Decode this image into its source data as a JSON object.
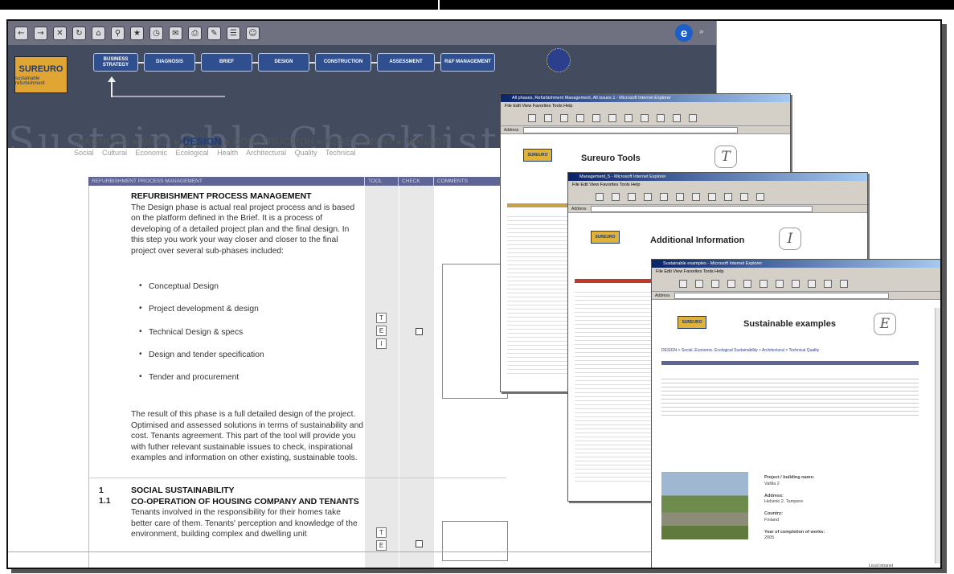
{
  "banner": {
    "logo": "SUREURO",
    "logo_sub": "sustainable refurbishment",
    "phases": [
      "BUSINESS STRATEGY",
      "DIAGNOSIS",
      "BRIEF",
      "DESIGN",
      "CONSTRUCTION",
      "ASSESSMENT",
      "R&F MANAGEMENT"
    ],
    "big_title": "Sustainable Checklist"
  },
  "breadcrumb": {
    "diagnosis": "DIAGNOSIS",
    "brief": "BRIEF",
    "design": "DESIGN",
    "construction": "CONSTRUCTION",
    "assessment": "ASSESSMENT",
    "manage": "MANAGE",
    "sep": "▸"
  },
  "aspects": "Social Cultural Economic Ecological Health Architectural Quality Technical",
  "table": {
    "headers": [
      "REFURBISHMENT PROCESS MANAGEMENT",
      "TOOL",
      "CHECK",
      "COMMENTS"
    ],
    "section1": {
      "title": "REFURBISHMENT PROCESS MANAGEMENT",
      "intro": "The Design phase is actual real project process and is based on the platform defined in the Brief. It is a process of developing of a detailed project plan and the final design. In this step you work your way closer and closer to the final project over several sub-phases included:",
      "bullets": [
        "Conceptual Design",
        "Project development & design",
        "Technical Design & specs",
        "Design and tender specification",
        "Tender and procurement"
      ],
      "outro": "The result of this phase is a full detailed design of the project. Optimised and assessed solutions in terms of sustainability and cost. Tenants agreement. This part of the tool will provide you with futher relevant sustainable issues to check, inspirational examples and information on other existing, sustainable tools.",
      "tools": [
        "T",
        "E",
        "I"
      ]
    },
    "section2": {
      "num1": "1",
      "num2": "1.1",
      "title1": "SOCIAL SUSTAINABILITY",
      "title2": "CO-OPERATION OF HOUSING COMPANY AND TENANTS",
      "text": "Tenants involved in the responsibility for their homes take better care of them. Tenants' perception and knowledge of the environment, building complex and dwelling unit",
      "tools": [
        "T",
        "E"
      ]
    }
  },
  "popups": {
    "tools": {
      "title": "All phases, Refurbishment Management, All issues 1 - Microsoft Internet Explorer",
      "heading": "Sureuro Tools",
      "letter": "T",
      "menu": "File  Edit  View  Favorites  Tools  Help"
    },
    "info": {
      "title": "Management_5 - Microsoft Internet Explorer",
      "heading": "Additional Information",
      "letter": "I",
      "menu": "File  Edit  View  Favorites  Tools  Help"
    },
    "examples": {
      "title": "Sustainable examples - Microsoft Internet Explorer",
      "heading": "Sustainable examples",
      "letter": "E",
      "menu": "File  Edit  View  Favorites  Tools  Help",
      "crumb": "DESIGN > Social, Economic, Ecological Sustainability > Architectural > Technical Quality",
      "fields": [
        {
          "label": "Project / building name:",
          "value": "Vallila 2"
        },
        {
          "label": "Address:",
          "value": "Helsinki 2, Tampere"
        },
        {
          "label": "Country:",
          "value": "Finland"
        },
        {
          "label": "Year of completion of works:",
          "value": "2005"
        }
      ],
      "status": "Local intranet"
    }
  },
  "colors": {
    "banner": "#424c5e",
    "accent": "#2f4f8f",
    "logo": "#e1a534",
    "header": "#5e6494"
  }
}
